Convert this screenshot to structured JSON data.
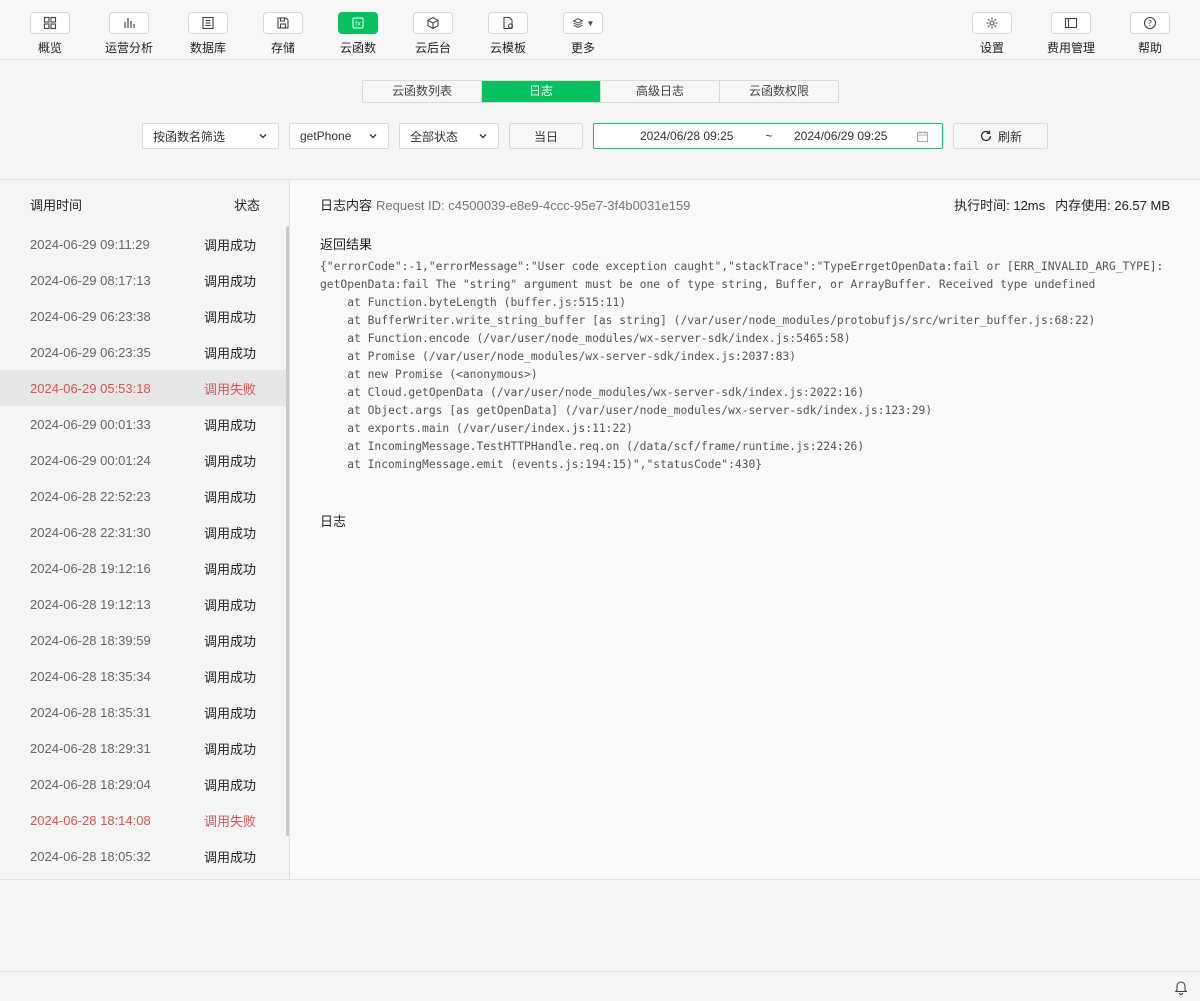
{
  "toolbar": {
    "left": [
      {
        "label": "概览",
        "icon": "grid-icon"
      },
      {
        "label": "运营分析",
        "icon": "bar-chart-icon"
      },
      {
        "label": "数据库",
        "icon": "database-icon"
      },
      {
        "label": "存储",
        "icon": "storage-icon"
      },
      {
        "label": "云函数",
        "icon": "function-icon",
        "active": true
      },
      {
        "label": "云后台",
        "icon": "cube-icon"
      },
      {
        "label": "云模板",
        "icon": "template-icon"
      },
      {
        "label": "更多",
        "icon": "layers-icon"
      }
    ],
    "right": [
      {
        "label": "设置",
        "icon": "gear-icon"
      },
      {
        "label": "费用管理",
        "icon": "billing-icon"
      },
      {
        "label": "帮助",
        "icon": "help-icon"
      }
    ]
  },
  "tabs": [
    {
      "label": "云函数列表",
      "active": false
    },
    {
      "label": "日志",
      "active": true
    },
    {
      "label": "高级日志",
      "active": false
    },
    {
      "label": "云函数权限",
      "active": false
    }
  ],
  "filters": {
    "filter_by": "按函数名筛选",
    "function_name": "getPhone",
    "status": "全部状态",
    "today_label": "当日",
    "date_start": "2024/06/28 09:25",
    "date_sep": "~",
    "date_end": "2024/06/29 09:25",
    "refresh_label": "刷新"
  },
  "log_list": {
    "col_time": "调用时间",
    "col_status": "状态",
    "rows": [
      {
        "time": "2024-06-29 09:11:29",
        "status": "调用成功",
        "failed": false
      },
      {
        "time": "2024-06-29 08:17:13",
        "status": "调用成功",
        "failed": false
      },
      {
        "time": "2024-06-29 06:23:38",
        "status": "调用成功",
        "failed": false
      },
      {
        "time": "2024-06-29 06:23:35",
        "status": "调用成功",
        "failed": false
      },
      {
        "time": "2024-06-29 05:53:18",
        "status": "调用失败",
        "failed": true,
        "selected": true
      },
      {
        "time": "2024-06-29 00:01:33",
        "status": "调用成功",
        "failed": false
      },
      {
        "time": "2024-06-29 00:01:24",
        "status": "调用成功",
        "failed": false
      },
      {
        "time": "2024-06-28 22:52:23",
        "status": "调用成功",
        "failed": false
      },
      {
        "time": "2024-06-28 22:31:30",
        "status": "调用成功",
        "failed": false
      },
      {
        "time": "2024-06-28 19:12:16",
        "status": "调用成功",
        "failed": false
      },
      {
        "time": "2024-06-28 19:12:13",
        "status": "调用成功",
        "failed": false
      },
      {
        "time": "2024-06-28 18:39:59",
        "status": "调用成功",
        "failed": false
      },
      {
        "time": "2024-06-28 18:35:34",
        "status": "调用成功",
        "failed": false
      },
      {
        "time": "2024-06-28 18:35:31",
        "status": "调用成功",
        "failed": false
      },
      {
        "time": "2024-06-28 18:29:31",
        "status": "调用成功",
        "failed": false
      },
      {
        "time": "2024-06-28 18:29:04",
        "status": "调用成功",
        "failed": false
      },
      {
        "time": "2024-06-28 18:14:08",
        "status": "调用失败",
        "failed": true
      },
      {
        "time": "2024-06-28 18:05:32",
        "status": "调用成功",
        "failed": false
      }
    ]
  },
  "detail": {
    "title": "日志内容",
    "request_id": "Request ID: c4500039-e8e9-4ccc-95e7-3f4b0031e159",
    "exec_time": "执行时间: 12ms",
    "memory": "内存使用: 26.57 MB",
    "result_title": "返回结果",
    "result_text": "{\"errorCode\":-1,\"errorMessage\":\"User code exception caught\",\"stackTrace\":\"TypeErrgetOpenData:fail or [ERR_INVALID_ARG_TYPE]: getOpenData:fail The \"string\" argument must be one of type string, Buffer, or ArrayBuffer. Received type undefined\n    at Function.byteLength (buffer.js:515:11)\n    at BufferWriter.write_string_buffer [as string] (/var/user/node_modules/protobufjs/src/writer_buffer.js:68:22)\n    at Function.encode (/var/user/node_modules/wx-server-sdk/index.js:5465:58)\n    at Promise (/var/user/node_modules/wx-server-sdk/index.js:2037:83)\n    at new Promise (<anonymous>)\n    at Cloud.getOpenData (/var/user/node_modules/wx-server-sdk/index.js:2022:16)\n    at Object.args [as getOpenData] (/var/user/node_modules/wx-server-sdk/index.js:123:29)\n    at exports.main (/var/user/index.js:11:22)\n    at IncomingMessage.TestHTTPHandle.req.on (/data/scf/frame/runtime.js:224:26)\n    at IncomingMessage.emit (events.js:194:15)\",\"statusCode\":430}",
    "log_title": "日志"
  },
  "colors": {
    "accent": "#07c160",
    "fail": "#d9534f"
  }
}
